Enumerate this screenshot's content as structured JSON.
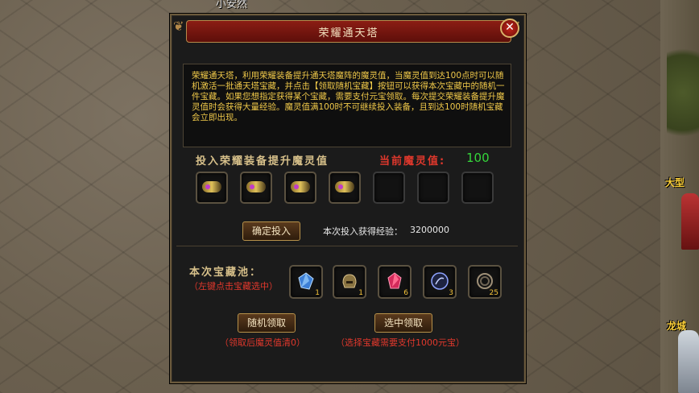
{
  "scene": {
    "player_name": "小安然",
    "npc_labels": [
      "大型",
      "龙城"
    ]
  },
  "panel": {
    "title": "荣耀通天塔",
    "close_icon": "✕",
    "description": "荣耀通天塔，利用荣耀装备提升通天塔魔阵的魔灵值，当魔灵值到达100点时可以随机激活一批通天塔宝藏，并点击【领取随机宝藏】按钮可以获得本次宝藏中的随机一件宝藏。如果您想指定获得某个宝藏，需要支付元宝领取。每次提交荣耀装备提升魔灵值时会获得大量经验。魔灵值满100时不可继续投入装备，且到达100时随机宝藏会立即出现。",
    "invest_title": "投入荣耀装备提升魔灵值",
    "magic_label": "当前魔灵值:",
    "magic_value": "100",
    "equipment_slots": [
      {
        "filled": true,
        "icon": "equipment-icon"
      },
      {
        "filled": true,
        "icon": "equipment-icon"
      },
      {
        "filled": true,
        "icon": "equipment-icon"
      },
      {
        "filled": true,
        "icon": "equipment-icon"
      },
      {
        "filled": false
      },
      {
        "filled": false
      },
      {
        "filled": false
      }
    ],
    "confirm_button": "确定投入",
    "exp_label": "本次投入获得经验：",
    "exp_value": "3200000",
    "pool_title": "本次宝藏池：",
    "pool_hint": "（左键点击宝藏选中）",
    "treasures": [
      {
        "icon": "blue-crystal-icon",
        "count": "1"
      },
      {
        "icon": "helmet-icon",
        "count": "1"
      },
      {
        "icon": "red-gem-icon",
        "count": "6"
      },
      {
        "icon": "dark-orb-icon",
        "count": "3"
      },
      {
        "icon": "ring-icon",
        "count": "25"
      }
    ],
    "random_button": "随机领取",
    "random_hint": "（领取后魔灵值清0）",
    "select_button": "选中领取",
    "select_hint": "（选择宝藏需要支付1000元宝）"
  },
  "colors": {
    "title_red": "#8b1d14",
    "text_gold": "#f0c94a",
    "hint_red": "#e0382c",
    "value_green": "#34d63a"
  }
}
